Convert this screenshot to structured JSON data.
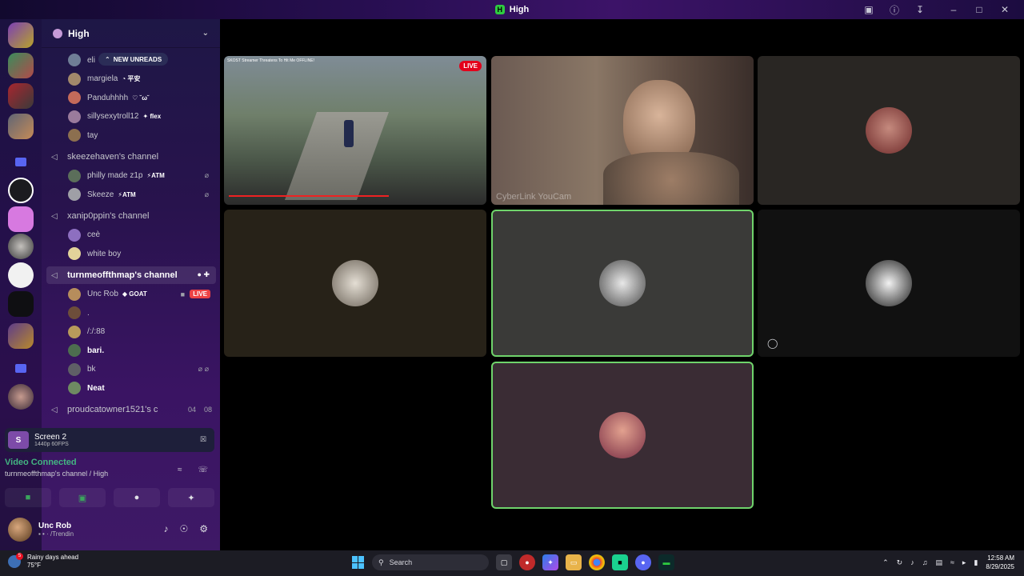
{
  "window": {
    "title": "High",
    "app_icon": "H"
  },
  "guild": {
    "name": "High"
  },
  "new_unreads": "NEW UNREADS",
  "top_users": [
    {
      "name": "eli",
      "tag": "",
      "color": "#6f7e96"
    },
    {
      "name": "margiela",
      "tag": "◔ 平安",
      "color": "#a2886b"
    },
    {
      "name": "Panduhhhh",
      "tag": "♡ ˘ω˘",
      "color": "#c46a5a"
    },
    {
      "name": "sillysexytroll12",
      "tag": "✦ flex",
      "color": "#9a7b9c"
    },
    {
      "name": "tay",
      "tag": "",
      "color": "#8c6f4f"
    }
  ],
  "channels": [
    {
      "name": "skeezehaven's channel",
      "users": [
        {
          "name": "philly made z1p",
          "tag": "⚡ATM",
          "color": "#5b6e5a",
          "icons": "⌀"
        },
        {
          "name": "Skeeze",
          "tag": "⚡ATM",
          "color": "#9f9fa6",
          "icons": "⌀"
        }
      ]
    },
    {
      "name": "xanip0ppin's channel",
      "users": [
        {
          "name": "ceè",
          "tag": "",
          "color": "#8d6fc0",
          "icons": ""
        },
        {
          "name": "white boy",
          "tag": "",
          "color": "#e2d39a",
          "icons": ""
        }
      ]
    },
    {
      "name": "turnmeoffthmap's channel",
      "active": true,
      "users": [
        {
          "name": "Unc Rob",
          "tag": "◆ GOAT",
          "color": "#b68d5c",
          "icons": "■",
          "live": "LIVE"
        },
        {
          "name": ".",
          "tag": "",
          "color": "#6d4d3a",
          "icons": ""
        },
        {
          "name": "/:/:88",
          "tag": "",
          "color": "#b89a5b",
          "icons": ""
        },
        {
          "name": "bari.",
          "tag": "",
          "color": "#4d6e4f",
          "icons": "",
          "bold": true
        },
        {
          "name": "bk",
          "tag": "",
          "color": "#5f5f66",
          "icons": "⌀ ⌀"
        },
        {
          "name": "Neat",
          "tag": "",
          "color": "#6e8a62",
          "icons": "",
          "bold": true
        }
      ]
    },
    {
      "name": "proudcatowner1521's c",
      "counts": [
        "04",
        "08"
      ]
    }
  ],
  "screen_share": {
    "thumb": "S",
    "title": "Screen 2",
    "sub": "1440p 60FPS"
  },
  "voice": {
    "status": "Video Connected",
    "location": "turnmeoffthmap's channel / High"
  },
  "user": {
    "name": "Unc Rob",
    "status": "▪ • · /Trendin"
  },
  "tiles": {
    "video_caption": "SKOST Streamer Threatens To Hit Me OFFLINE!",
    "live_badge": "LIVE",
    "cam_overlay": "CyberLink YouCam"
  },
  "taskbar": {
    "weather_badge": "5",
    "weather_text": "Rainy days ahead",
    "weather_temp": "75°F",
    "search_placeholder": "Search",
    "time": "12:58 AM",
    "date": "8/29/2025"
  },
  "colors": {
    "accent": "#5865f2",
    "live": "#ed4245",
    "speaking": "#6fd36b",
    "connected": "#43b581"
  }
}
